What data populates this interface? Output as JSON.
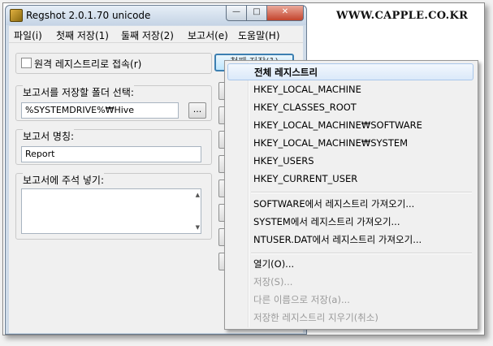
{
  "watermark": "WWW.CAPPLE.CO.KR",
  "window": {
    "title": "Regshot 2.0.1.70 unicode",
    "min_icon": "minimize-icon",
    "max_icon": "maximize-icon",
    "close_icon": "close-icon"
  },
  "menubar": {
    "items": [
      "파일(i)",
      "첫째 저장(1)",
      "둘째 저장(2)",
      "보고서(e)",
      "도움말(H)"
    ]
  },
  "remote": {
    "label": "원격 레지스트리로 접속(r)",
    "checked": false
  },
  "folder": {
    "label": "보고서를 저장할 폴더 선택:",
    "value": "%SYSTEMDRIVE%₩Hive",
    "browse_label": "..."
  },
  "report_name": {
    "label": "보고서 명칭:",
    "value": "Report"
  },
  "comment": {
    "label": "보고서에 주석 넣기:",
    "value": ""
  },
  "first_shot_button": {
    "label": "첫째 저장(1)"
  },
  "context_menu": {
    "items": [
      {
        "label": "전체 레지스트리",
        "highlighted": true,
        "disabled": false
      },
      {
        "label": "HKEY_LOCAL_MACHINE",
        "highlighted": false,
        "disabled": false
      },
      {
        "label": "HKEY_CLASSES_ROOT",
        "highlighted": false,
        "disabled": false
      },
      {
        "label": "HKEY_LOCAL_MACHINE₩SOFTWARE",
        "highlighted": false,
        "disabled": false
      },
      {
        "label": "HKEY_LOCAL_MACHINE₩SYSTEM",
        "highlighted": false,
        "disabled": false
      },
      {
        "label": "HKEY_USERS",
        "highlighted": false,
        "disabled": false
      },
      {
        "label": "HKEY_CURRENT_USER",
        "highlighted": false,
        "disabled": false
      },
      {
        "label": "SOFTWARE에서 레지스트리 가져오기...",
        "highlighted": false,
        "disabled": false
      },
      {
        "label": "SYSTEM에서 레지스트리 가져오기...",
        "highlighted": false,
        "disabled": false
      },
      {
        "label": "NTUSER.DAT에서 레지스트리 가져오기...",
        "highlighted": false,
        "disabled": false
      },
      {
        "label": "열기(O)...",
        "highlighted": false,
        "disabled": false
      },
      {
        "label": "저장(S)...",
        "highlighted": false,
        "disabled": true
      },
      {
        "label": "다른 이름으로 저장(a)...",
        "highlighted": false,
        "disabled": true
      },
      {
        "label": "저장한 레지스트리 지우기(취소)",
        "highlighted": false,
        "disabled": true
      }
    ]
  }
}
